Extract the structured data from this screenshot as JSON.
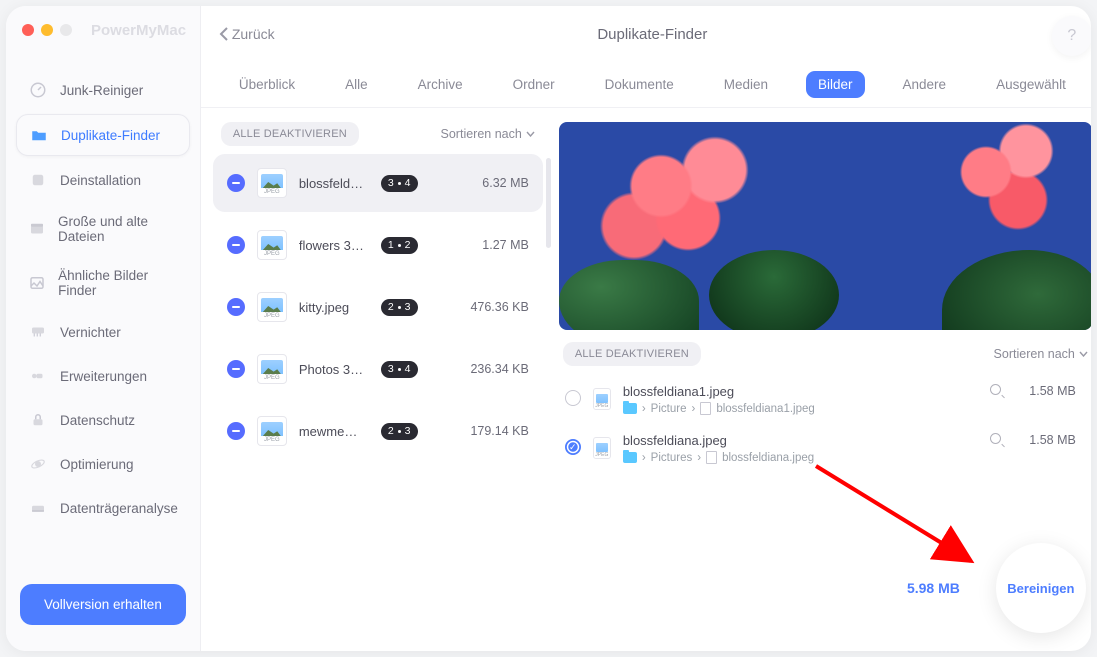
{
  "brand": "PowerMyMac",
  "header": {
    "back": "Zurück",
    "title": "Duplikate-Finder",
    "help": "?"
  },
  "sidebar": {
    "items": [
      {
        "label": "Junk-Reiniger"
      },
      {
        "label": "Duplikate-Finder"
      },
      {
        "label": "Deinstallation"
      },
      {
        "label": "Große und alte Dateien"
      },
      {
        "label": "Ähnliche Bilder Finder"
      },
      {
        "label": "Vernichter"
      },
      {
        "label": "Erweiterungen"
      },
      {
        "label": "Datenschutz"
      },
      {
        "label": "Optimierung"
      },
      {
        "label": "Datenträgeranalyse"
      }
    ],
    "cta": "Vollversion erhalten"
  },
  "tabs": [
    "Überblick",
    "Alle",
    "Archive",
    "Ordner",
    "Dokumente",
    "Medien",
    "Bilder",
    "Andere",
    "Ausgewählt"
  ],
  "list": {
    "deactivate_all": "ALLE DEAKTIVIEREN",
    "sort": "Sortieren nach",
    "thumb_type": "JPEG",
    "groups": [
      {
        "name": "blossfeld…",
        "count": "3",
        "total": "4",
        "size": "6.32 MB"
      },
      {
        "name": "flowers 3…",
        "count": "1",
        "total": "2",
        "size": "1.27 MB"
      },
      {
        "name": "kitty.jpeg",
        "count": "2",
        "total": "3",
        "size": "476.36 KB"
      },
      {
        "name": "Photos 3…",
        "count": "3",
        "total": "4",
        "size": "236.34 KB"
      },
      {
        "name": "mewme…",
        "count": "2",
        "total": "3",
        "size": "179.14 KB"
      }
    ]
  },
  "detail": {
    "deactivate_all": "ALLE DEAKTIVIEREN",
    "sort": "Sortieren nach",
    "chev": "›",
    "items": [
      {
        "name": "blossfeldiana1.jpeg",
        "folder": "Picture",
        "file": "blossfeldiana1.jpeg",
        "size": "1.58 MB",
        "checked": false
      },
      {
        "name": "blossfeldiana.jpeg",
        "folder": "Pictures",
        "file": "blossfeldiana.jpeg",
        "size": "1.58 MB",
        "checked": true
      }
    ]
  },
  "footer": {
    "total": "5.98 MB",
    "clean": "Bereinigen"
  }
}
